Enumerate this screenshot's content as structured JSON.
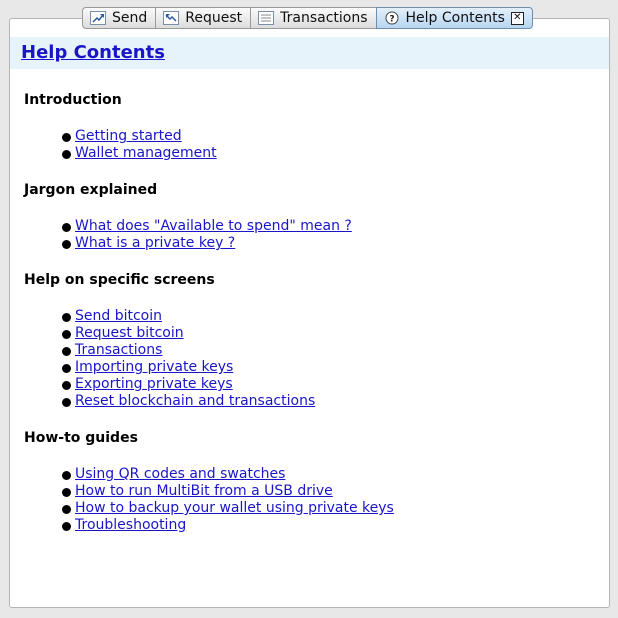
{
  "tabs": [
    {
      "label": "Send",
      "icon": "send-icon"
    },
    {
      "label": "Request",
      "icon": "request-icon"
    },
    {
      "label": "Transactions",
      "icon": "transactions-icon"
    },
    {
      "label": "Help Contents",
      "icon": "help-icon",
      "active": true
    }
  ],
  "page": {
    "title": "Help Contents"
  },
  "sections": [
    {
      "heading": "Introduction",
      "links": [
        "Getting started",
        "Wallet management"
      ]
    },
    {
      "heading": "Jargon explained",
      "links": [
        "What does \"Available to spend\" mean ?",
        "What is a private key ?"
      ]
    },
    {
      "heading": "Help on specific screens",
      "links": [
        "Send bitcoin",
        "Request bitcoin",
        "Transactions",
        "Importing private keys",
        "Exporting private keys",
        "Reset blockchain and transactions"
      ]
    },
    {
      "heading": "How-to guides",
      "links": [
        "Using QR codes and swatches",
        "How to run MultiBit from a USB drive",
        "How to backup your wallet using private keys",
        "Troubleshooting"
      ]
    }
  ],
  "colors": {
    "link": "#1a16c8",
    "header_bg": "#e6f3fb"
  }
}
